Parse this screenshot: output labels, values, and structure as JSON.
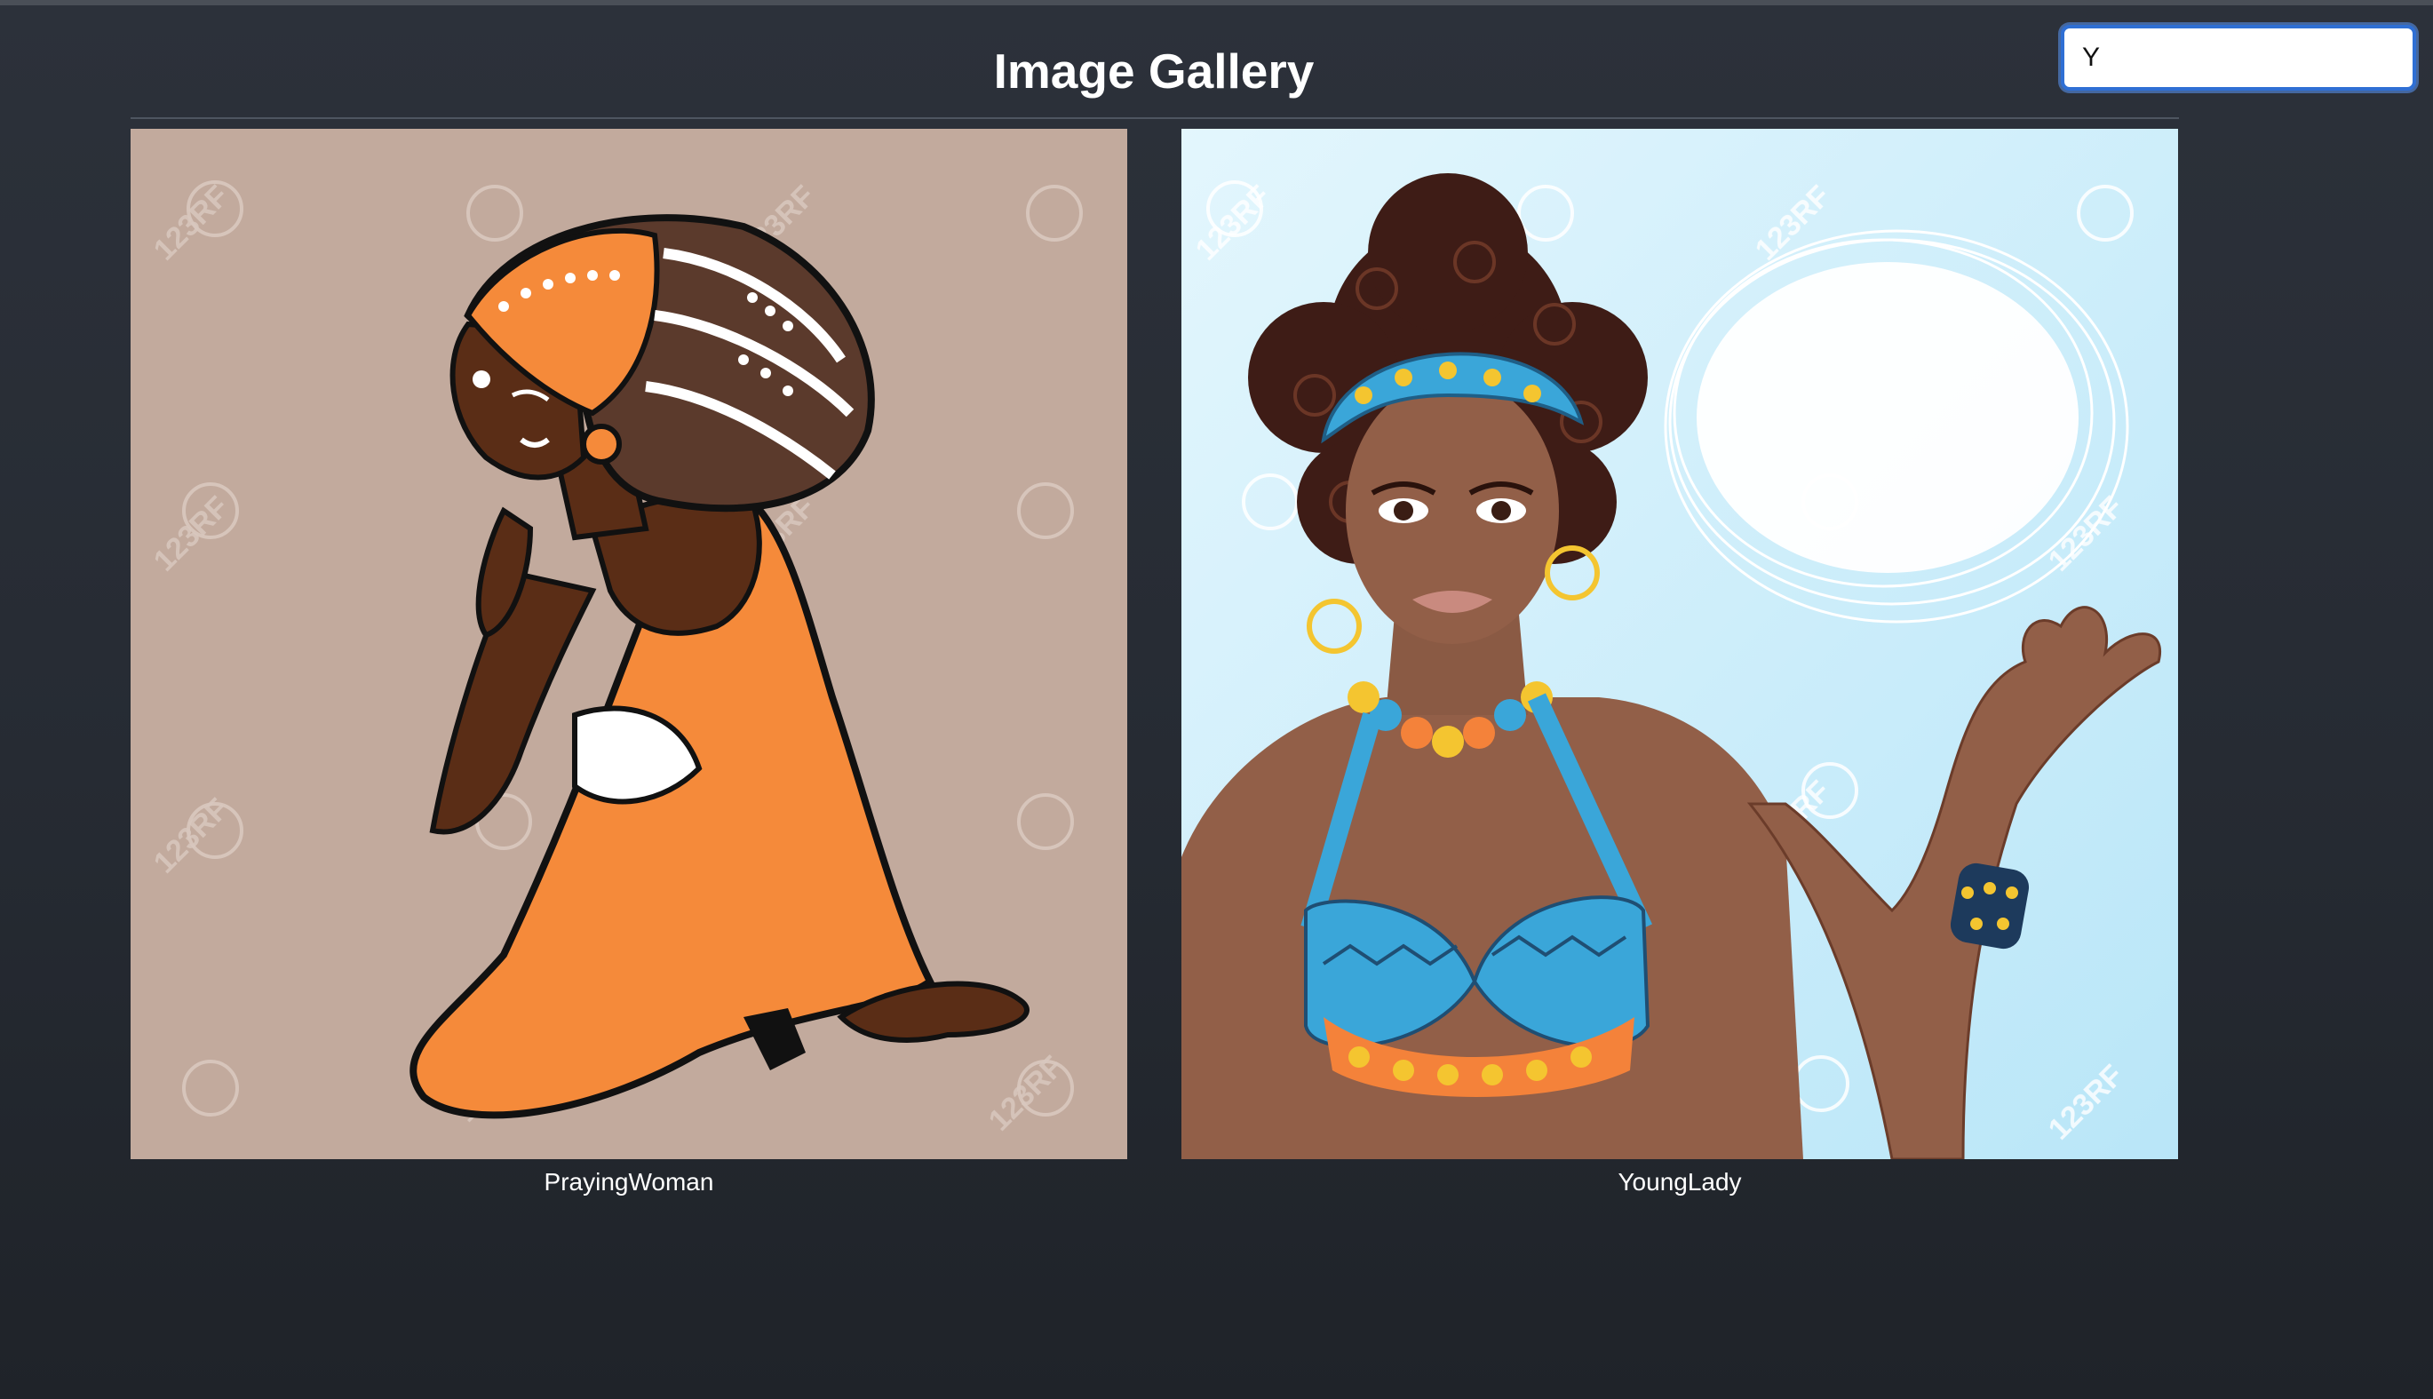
{
  "header": {
    "title": "Image Gallery"
  },
  "search": {
    "value": "Y"
  },
  "gallery": {
    "items": [
      {
        "caption": "PrayingWoman",
        "watermark": "123RF"
      },
      {
        "caption": "YoungLady",
        "watermark": "123RF"
      }
    ]
  },
  "colors": {
    "background": "#2a2f37",
    "title_text": "#ffffff",
    "caption_text": "#ffffff",
    "search_focus_border": "#2f6fd4",
    "praying_bg": "#c2aa9d",
    "praying_dress": "#f58a3a",
    "praying_skin": "#5a2d16",
    "praying_headwrap": "#5b3a2c",
    "younglady_sky": "#d3f0fb",
    "younglady_skin": "#925f48",
    "younglady_hair": "#3e1c16",
    "younglady_pattern_blue": "#3aa6d9",
    "younglady_pattern_orange": "#f4823a"
  }
}
